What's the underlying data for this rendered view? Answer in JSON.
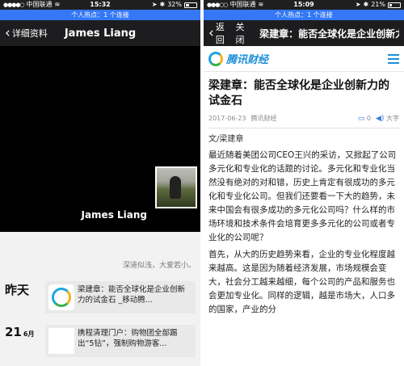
{
  "left": {
    "status": {
      "signal": "●●●●○",
      "carrier": "中国联通",
      "wifi": "≋",
      "time": "15:32",
      "location": "➤",
      "bluetooth": "✱",
      "battery": "32%",
      "battery_level": 0.32
    },
    "hotspot": "个人热点：1 个连接",
    "nav": {
      "back_label": "详细资料",
      "title": "James Liang"
    },
    "profile": {
      "name": "James Liang",
      "signature": "深道似浅，大爱若小。"
    },
    "feed": [
      {
        "day": "昨天",
        "month": "",
        "text": "梁建章：能否全球化是企业创新力的试金石 _移动腾...",
        "thumb": "qq-news-logo"
      },
      {
        "day": "21",
        "month": "6月",
        "text": "携程清理门户：购物团全部踢出“5钻”，强制购物游客...",
        "thumb": "plane-icon"
      }
    ]
  },
  "right": {
    "status": {
      "signal": "●●●○○",
      "carrier": "中国联通",
      "wifi": "≋",
      "time": "15:09",
      "location": "➤",
      "bluetooth": "✱",
      "battery": "21%",
      "battery_level": 0.21
    },
    "hotspot": "个人热点：1 个连接",
    "nav": {
      "back_label": "返回",
      "close_label": "关闭",
      "title": "梁建章：能否全球化是企业创新力..."
    },
    "site": {
      "logo_text": "腾讯财经"
    },
    "article": {
      "title": "梁建章：能否全球化是企业创新力的试金石",
      "date": "2017-06-23",
      "source": "腾讯财经",
      "comments": "0",
      "font_label": "大字",
      "byline": "文/梁建章",
      "paragraphs": [
        "最近随着美团公司CEO王兴的采访，又掀起了公司多元化和专业化的话题的讨论。多元化和专业化当然没有绝对的对和错，历史上肯定有很成功的多元化和专业化公司。但我们还要看一下大的趋势，未来中国会有很多成功的多元化公司吗？什么样的市场环境和技术条件会培育更多多元化的公司或者专业化的公司呢？",
        "首先，从大的历史趋势来看，企业的专业化程度越来越高。这是因为随着经济发展，市场规模会变大，社会分工越来越细，每个公司的产品和服务也会更加专业化。同样的逻辑，越是市场大，人口多的国家，产业的分"
      ]
    }
  }
}
